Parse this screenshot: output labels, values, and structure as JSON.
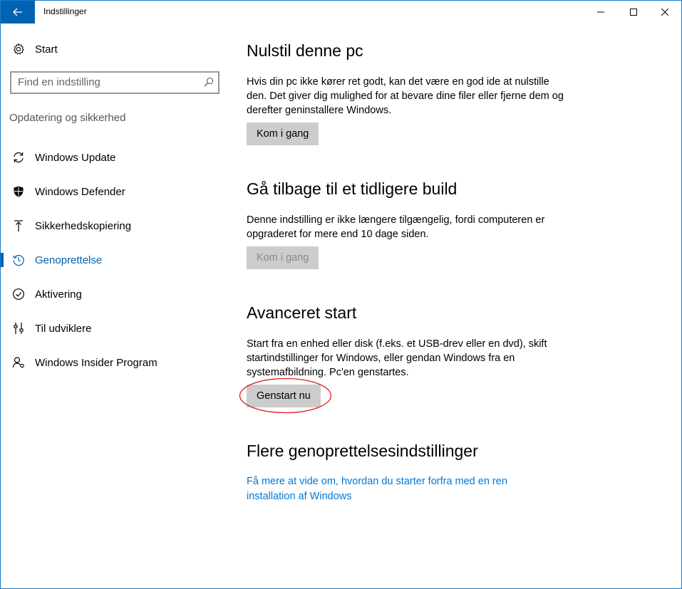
{
  "app": {
    "title": "Indstillinger"
  },
  "sidebar": {
    "home_label": "Start",
    "search": {
      "placeholder": "Find en indstilling"
    },
    "section_header": "Opdatering og sikkerhed",
    "items": [
      {
        "label": "Windows Update",
        "icon": "sync-icon",
        "active": false
      },
      {
        "label": "Windows Defender",
        "icon": "shield-icon",
        "active": false
      },
      {
        "label": "Sikkerhedskopiering",
        "icon": "backup-arrow-icon",
        "active": false
      },
      {
        "label": "Genoprettelse",
        "icon": "history-icon",
        "active": true
      },
      {
        "label": "Aktivering",
        "icon": "check-circle-icon",
        "active": false
      },
      {
        "label": "Til udviklere",
        "icon": "developer-icon",
        "active": false
      },
      {
        "label": "Windows Insider Program",
        "icon": "insider-person-icon",
        "active": false
      }
    ]
  },
  "main": {
    "reset": {
      "title": "Nulstil denne pc",
      "description": "Hvis din pc ikke kører ret godt, kan det være en god ide at nulstille den. Det giver dig mulighed for at bevare dine filer eller fjerne dem og derefter geninstallere Windows.",
      "button": "Kom i gang"
    },
    "go_back": {
      "title": "Gå tilbage til et tidligere build",
      "description": "Denne indstilling er ikke længere tilgængelig, fordi computeren er opgraderet for mere end 10 dage siden.",
      "button": "Kom i gang",
      "button_disabled": true
    },
    "advanced": {
      "title": "Avanceret start",
      "description": "Start fra en enhed eller disk (f.eks. et USB-drev eller en dvd), skift startindstillinger for Windows, eller gendan Windows fra en systemafbildning. Pc'en genstartes.",
      "button": "Genstart nu"
    },
    "more": {
      "title": "Flere genoprettelsesindstillinger",
      "link": "Få mere at vide om, hvordan du starter forfra med en ren installation af Windows"
    }
  },
  "colors": {
    "accent": "#0063b1",
    "link": "#0078d7",
    "button_bg": "#cccccc",
    "annotation": "#e0191a"
  }
}
